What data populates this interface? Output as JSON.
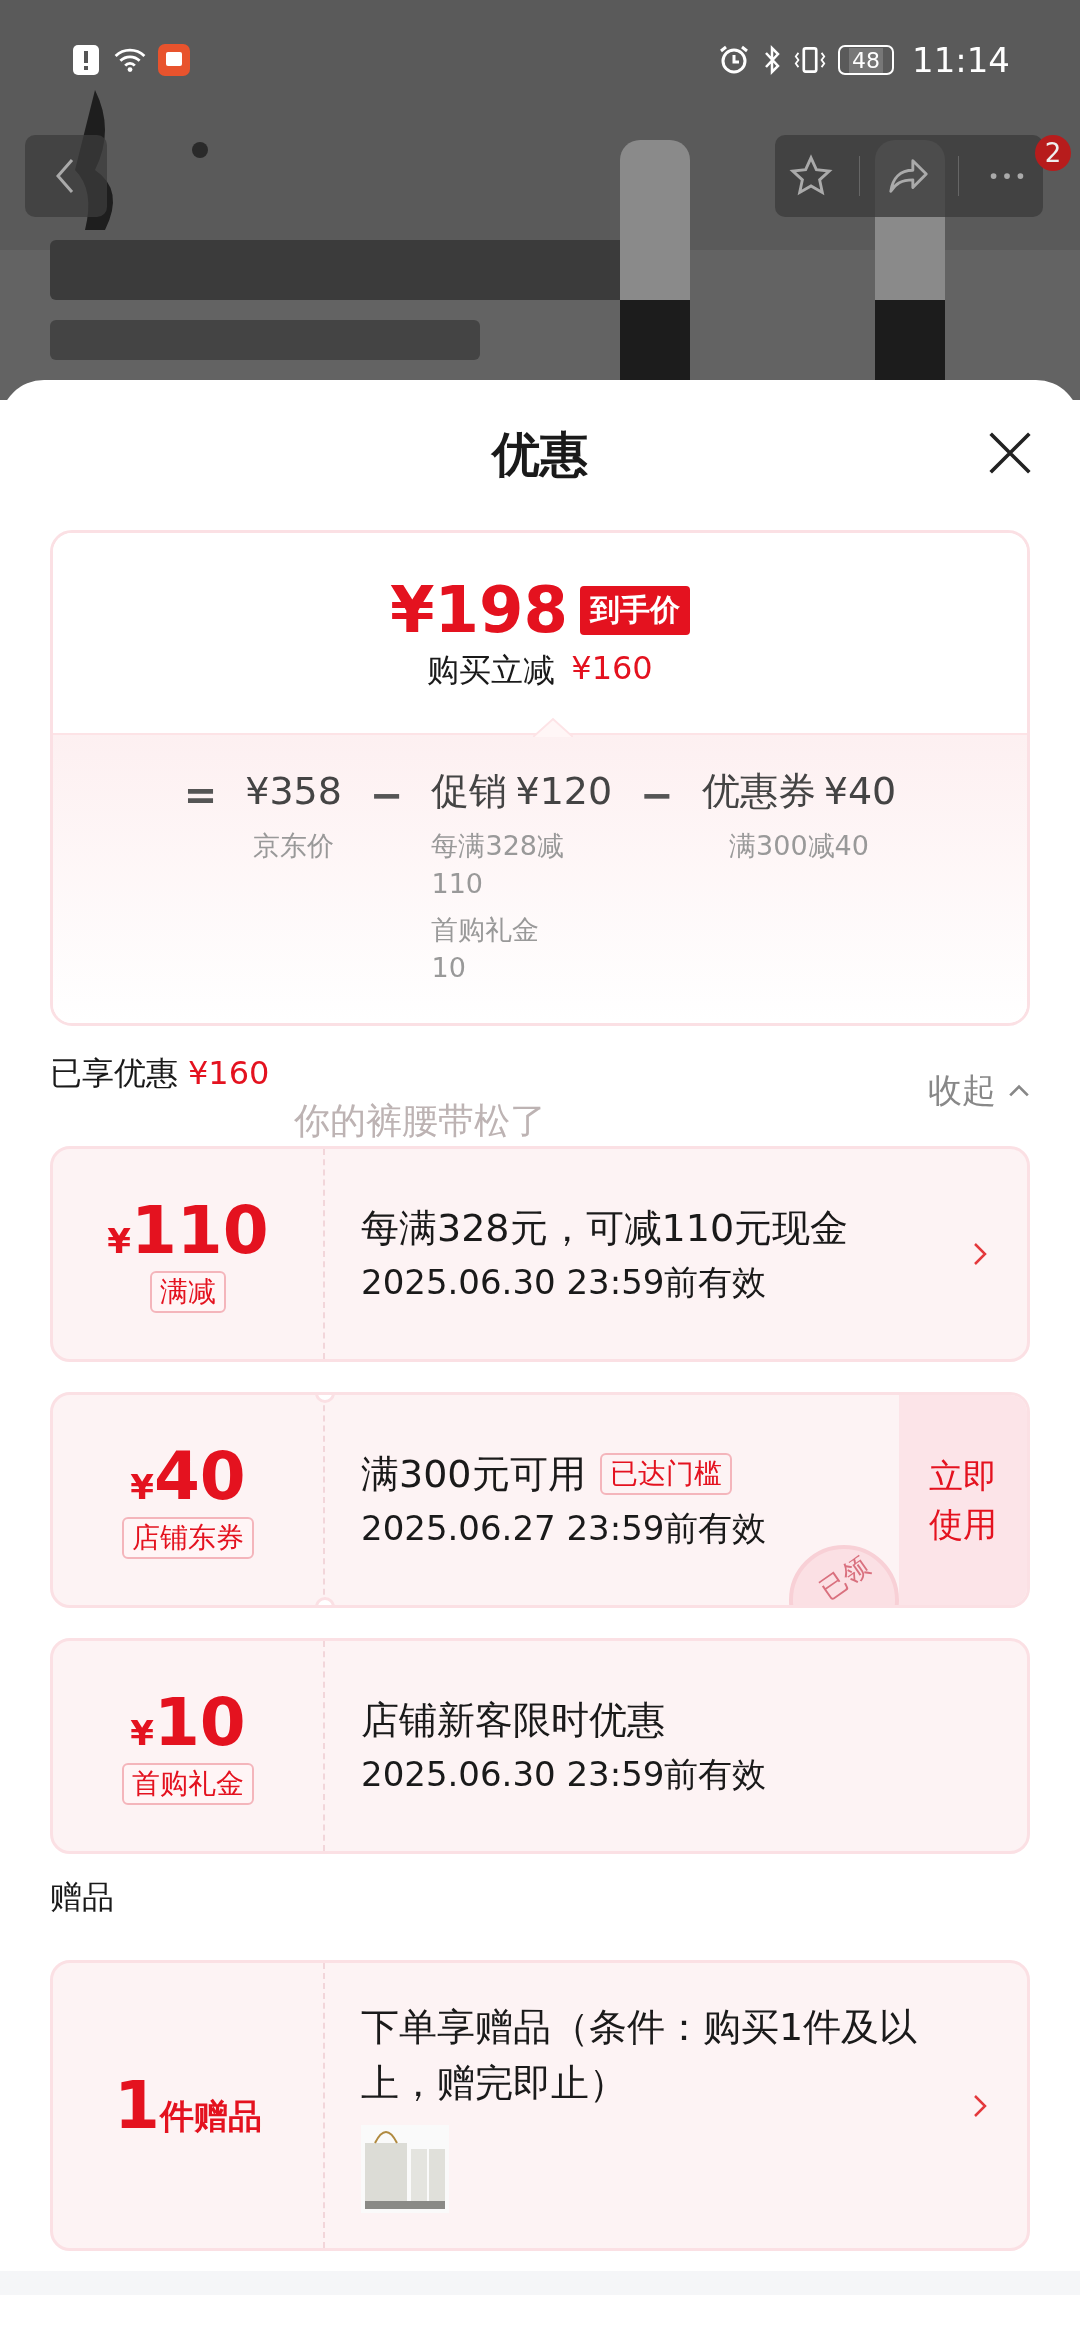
{
  "status_bar": {
    "time": "11:14",
    "battery": "48"
  },
  "top_actions": {
    "badge": "2"
  },
  "sheet": {
    "title": "优惠"
  },
  "price_summary": {
    "final_price": "¥198",
    "final_tag": "到手价",
    "discount_label": "购买立减",
    "discount": "¥160",
    "breakdown": [
      {
        "kind": "base",
        "operator": "=",
        "amount": "¥358",
        "notes": [
          {
            "label": "京东价"
          }
        ]
      },
      {
        "kind": "minus",
        "operator": "−",
        "label": "促销",
        "amount": "¥120",
        "notes": [
          {
            "label": "每满328减",
            "value": "110"
          },
          {
            "label": "首购礼金",
            "value": "10"
          }
        ]
      },
      {
        "kind": "minus",
        "operator": "−",
        "label": "优惠券",
        "amount": "¥40",
        "notes": [
          {
            "label": "满300减40"
          }
        ]
      }
    ]
  },
  "enjoyed": {
    "label": "已享优惠",
    "amount": "¥160",
    "toggle": "收起",
    "expanded": true
  },
  "overlay_text": "你的裤腰带松了",
  "coupons": [
    {
      "kind": "promo",
      "currency": "¥",
      "amount": "110",
      "tag": "满减",
      "title": "每满328元，可减110元现金",
      "validity": "2025.06.30 23:59前有效",
      "arrow": true
    },
    {
      "kind": "coupon",
      "currency": "¥",
      "amount": "40",
      "tag": "店铺东券",
      "title": "满300元可用",
      "status_tag": "已达门槛",
      "validity": "2025.06.27 23:59前有效",
      "action": "立即使用",
      "stamp": "已领",
      "arrow": false
    },
    {
      "kind": "promo",
      "currency": "¥",
      "amount": "10",
      "tag": "首购礼金",
      "title": "店铺新客限时优惠",
      "validity": "2025.06.30 23:59前有效",
      "arrow": false
    }
  ],
  "gifts": {
    "heading": "赠品",
    "items": [
      {
        "count": "1",
        "unit": "件赠品",
        "title": "下单享赠品（条件：购买1件及以上，赠完即止）",
        "arrow": true
      }
    ]
  }
}
